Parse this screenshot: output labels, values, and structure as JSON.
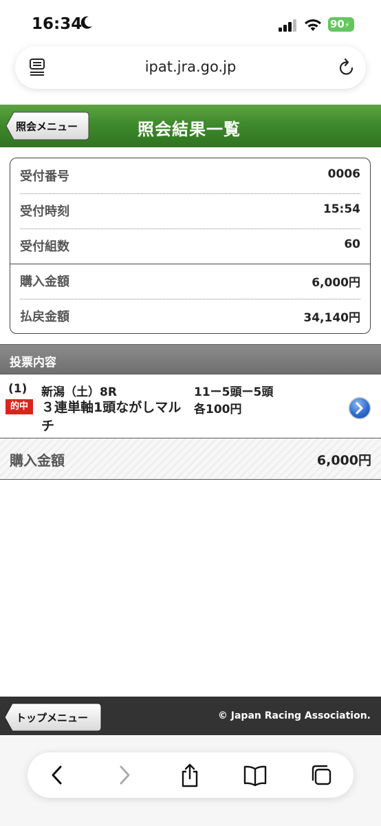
{
  "status_bar": {
    "time": "16:34",
    "battery": "90",
    "icons": [
      "moon-icon",
      "signal-icon",
      "wifi-icon",
      "battery-icon"
    ]
  },
  "address_bar": {
    "url": "ipat.jra.go.jp",
    "icons": [
      "reader-icon",
      "reload-icon"
    ]
  },
  "header": {
    "back_label": "照会メニュー",
    "title": "照会結果一覧",
    "color": "#3f8a2c"
  },
  "receipt": {
    "rows": [
      {
        "label": "受付番号",
        "value": "0006"
      },
      {
        "label": "受付時刻",
        "value": "15:54"
      },
      {
        "label": "受付組数",
        "value": "60"
      },
      {
        "label": "購入金額",
        "value": "6,000円"
      },
      {
        "label": "払戻金額",
        "value": "34,140円"
      }
    ]
  },
  "bets": {
    "section_title": "投票内容",
    "items": [
      {
        "index": "(1)",
        "race": "新潟（土）8R",
        "status": "的中",
        "bet_type": "３連単軸1頭ながしマルチ",
        "combination": "11ー5頭ー5頭",
        "amount": "各100円"
      }
    ],
    "total_label": "購入金額",
    "total_value": "6,000円",
    "hit_color": "#d8261d"
  },
  "footer": {
    "top_menu_label": "トップメニュー",
    "copyright": "© Japan Racing Association."
  },
  "toolbar": {
    "icons": [
      "back-icon",
      "forward-icon",
      "share-icon",
      "bookmarks-icon",
      "tabs-icon"
    ]
  }
}
